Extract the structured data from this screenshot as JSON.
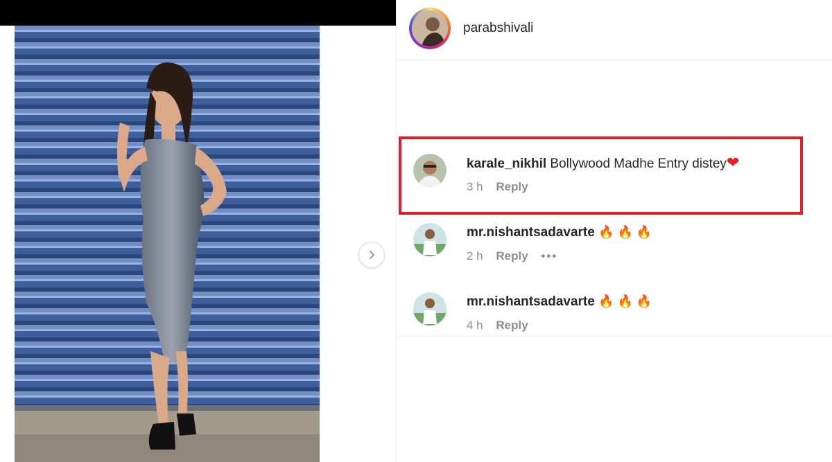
{
  "post": {
    "username": "parabshivali",
    "next_icon": "chevron-right-icon"
  },
  "comments": [
    {
      "username": "karale_nikhil",
      "text": "Bollywood Madhe Entry distey",
      "emoji": "❤",
      "time": "3 h",
      "reply_label": "Reply",
      "highlighted": true
    },
    {
      "username": "mr.nishantsadavarte",
      "text": "",
      "emoji": "🔥 🔥 🔥",
      "time": "2 h",
      "reply_label": "Reply",
      "more_label": "•••"
    },
    {
      "username": "mr.nishantsadavarte",
      "text": "",
      "emoji": "🔥 🔥 🔥",
      "time": "4 h",
      "reply_label": "Reply"
    }
  ],
  "colors": {
    "highlight_border": "#e11d2a",
    "heart": "#ed1c24",
    "fire": "#f97316"
  }
}
